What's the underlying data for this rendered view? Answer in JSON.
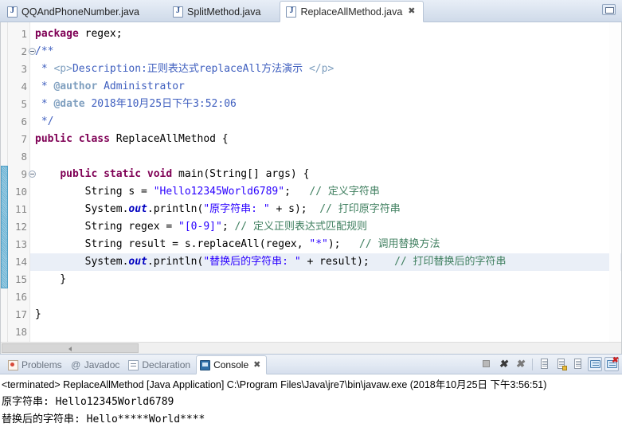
{
  "window": {
    "restore_button_name": "restore-editor-button"
  },
  "editor_tabs": [
    {
      "label": "QQAndPhoneNumber.java",
      "icon": "java-file-icon",
      "active": false,
      "close": ""
    },
    {
      "label": "SplitMethod.java",
      "icon": "java-file-icon",
      "active": false,
      "close": ""
    },
    {
      "label": "ReplaceAllMethod.java",
      "icon": "java-file-icon",
      "active": true,
      "close": "✖"
    }
  ],
  "editor": {
    "line_numbers": [
      "1",
      "2",
      "3",
      "4",
      "5",
      "6",
      "7",
      "8",
      "9",
      "10",
      "11",
      "12",
      "13",
      "14",
      "15",
      "16",
      "17",
      "18"
    ],
    "fold_lines": [
      2,
      9
    ],
    "highlighted_line": 14,
    "marker_bar_from": 9,
    "marker_bar_to": 15,
    "lines": [
      {
        "n": 1,
        "segs": [
          {
            "t": "package ",
            "c": "kw"
          },
          {
            "t": "regex;",
            "c": "plain"
          }
        ]
      },
      {
        "n": 2,
        "segs": [
          {
            "t": "/**",
            "c": "jdoc"
          }
        ]
      },
      {
        "n": 3,
        "segs": [
          {
            "t": " * ",
            "c": "jdoc"
          },
          {
            "t": "<p>",
            "c": "jtag"
          },
          {
            "t": "Description:正则表达式replaceAll方法演示 ",
            "c": "jdoc"
          },
          {
            "t": "</p>",
            "c": "jtag"
          }
        ]
      },
      {
        "n": 4,
        "segs": [
          {
            "t": " * ",
            "c": "jdoc"
          },
          {
            "t": "@author",
            "c": "jkey"
          },
          {
            "t": " Administrator",
            "c": "jdoc"
          }
        ]
      },
      {
        "n": 5,
        "segs": [
          {
            "t": " * ",
            "c": "jdoc"
          },
          {
            "t": "@date",
            "c": "jkey"
          },
          {
            "t": " 2018年10月25日下午3:52:06",
            "c": "jdoc"
          }
        ]
      },
      {
        "n": 6,
        "segs": [
          {
            "t": " */",
            "c": "jdoc"
          }
        ]
      },
      {
        "n": 7,
        "segs": [
          {
            "t": "public class ",
            "c": "kw"
          },
          {
            "t": "ReplaceAllMethod {",
            "c": "plain"
          }
        ]
      },
      {
        "n": 8,
        "segs": [
          {
            "t": "",
            "c": "plain"
          }
        ]
      },
      {
        "n": 9,
        "segs": [
          {
            "t": "    ",
            "c": "plain"
          },
          {
            "t": "public static void ",
            "c": "kw"
          },
          {
            "t": "main(String[] args) {",
            "c": "plain"
          }
        ]
      },
      {
        "n": 10,
        "segs": [
          {
            "t": "        String s = ",
            "c": "plain"
          },
          {
            "t": "\"Hello12345World6789\"",
            "c": "str"
          },
          {
            "t": ";   ",
            "c": "plain"
          },
          {
            "t": "// 定义字符串",
            "c": "cmt"
          }
        ]
      },
      {
        "n": 11,
        "segs": [
          {
            "t": "        System.",
            "c": "plain"
          },
          {
            "t": "out",
            "c": "fld"
          },
          {
            "t": ".println(",
            "c": "plain"
          },
          {
            "t": "\"原字符串: \"",
            "c": "str"
          },
          {
            "t": " + s);  ",
            "c": "plain"
          },
          {
            "t": "// 打印原字符串",
            "c": "cmt"
          }
        ]
      },
      {
        "n": 12,
        "segs": [
          {
            "t": "        String regex = ",
            "c": "plain"
          },
          {
            "t": "\"[0-9]\"",
            "c": "str"
          },
          {
            "t": "; ",
            "c": "plain"
          },
          {
            "t": "// 定义正则表达式匹配规则",
            "c": "cmt"
          }
        ]
      },
      {
        "n": 13,
        "segs": [
          {
            "t": "        String result = s.replaceAll(regex, ",
            "c": "plain"
          },
          {
            "t": "\"*\"",
            "c": "str"
          },
          {
            "t": ");   ",
            "c": "plain"
          },
          {
            "t": "// 调用替换方法",
            "c": "cmt"
          }
        ]
      },
      {
        "n": 14,
        "segs": [
          {
            "t": "        System.",
            "c": "plain"
          },
          {
            "t": "out",
            "c": "fld"
          },
          {
            "t": ".println(",
            "c": "plain"
          },
          {
            "t": "\"替换后的字符串: \"",
            "c": "str"
          },
          {
            "t": " + result);    ",
            "c": "plain"
          },
          {
            "t": "// 打印替换后的字符串",
            "c": "cmt"
          }
        ]
      },
      {
        "n": 15,
        "segs": [
          {
            "t": "    }",
            "c": "plain"
          }
        ]
      },
      {
        "n": 16,
        "segs": [
          {
            "t": "",
            "c": "plain"
          }
        ]
      },
      {
        "n": 17,
        "segs": [
          {
            "t": "}",
            "c": "plain"
          }
        ]
      },
      {
        "n": 18,
        "segs": [
          {
            "t": "",
            "c": "plain"
          }
        ]
      }
    ]
  },
  "console_tabs": [
    {
      "label": "Problems",
      "icon": "problems-icon",
      "active": false,
      "close": ""
    },
    {
      "label": "Javadoc",
      "icon": "javadoc-icon",
      "active": false,
      "close": ""
    },
    {
      "label": "Declaration",
      "icon": "declaration-icon",
      "active": false,
      "close": ""
    },
    {
      "label": "Console",
      "icon": "console-icon",
      "active": true,
      "close": "✖"
    }
  ],
  "console_toolbar": [
    {
      "name": "terminate-button",
      "glyph": "stop"
    },
    {
      "name": "remove-launch-button",
      "glyph": "x"
    },
    {
      "name": "remove-all-terminated-button",
      "glyph": "xx"
    },
    {
      "name": "separator",
      "glyph": "sep"
    },
    {
      "name": "clear-console-button",
      "glyph": "doc"
    },
    {
      "name": "scroll-lock-button",
      "glyph": "lock"
    },
    {
      "name": "word-wrap-button",
      "glyph": "docwrap"
    },
    {
      "name": "pin-console-button",
      "glyph": "monitor"
    },
    {
      "name": "display-selected-console-button",
      "glyph": "monitor-x"
    }
  ],
  "console": {
    "status_line": "<terminated> ReplaceAllMethod [Java Application] C:\\Program Files\\Java\\jre7\\bin\\javaw.exe (2018年10月25日 下午3:56:51)",
    "output_lines": [
      "原字符串: Hello12345World6789",
      "替换后的字符串: Hello*****World****"
    ]
  },
  "colors": {
    "keyword": "#7f0055",
    "string": "#2a00ff",
    "comment": "#3f7f5f",
    "javadoc": "#3f5fbf",
    "field": "#0000c0",
    "marker_bar": "#6cb3d4",
    "active_line": "#eaeff7"
  }
}
